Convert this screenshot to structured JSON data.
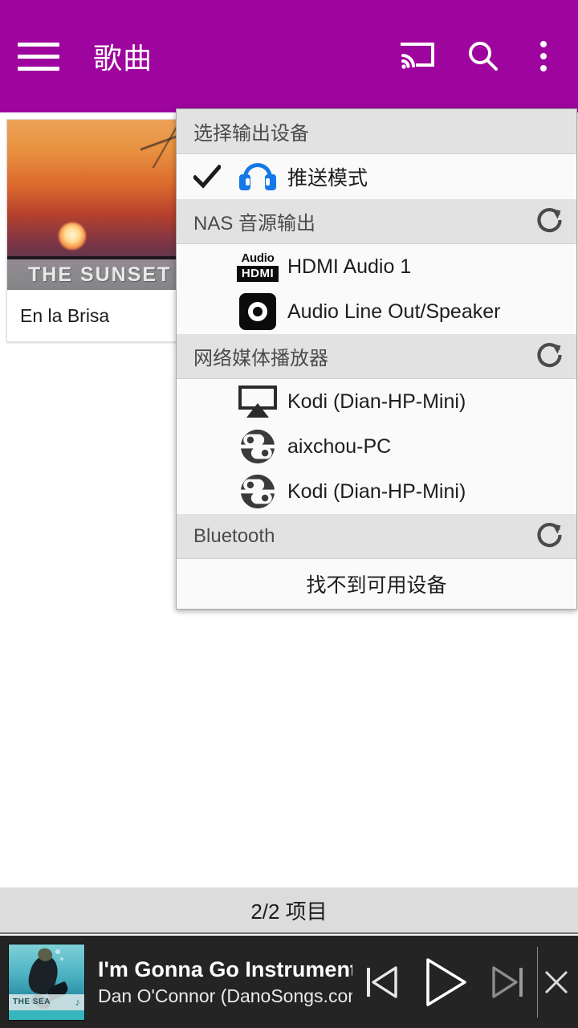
{
  "appbar": {
    "title": "歌曲",
    "menu_icon": "hamburger-menu-icon",
    "cast_icon": "cast-icon",
    "search_icon": "search-icon",
    "overflow_icon": "more-vertical-icon",
    "background_color": "#9E059E"
  },
  "content": {
    "cards": [
      {
        "title": "En la Brisa",
        "art_banner_text": "THE SUNSET"
      }
    ]
  },
  "output_menu": {
    "header": "选择输出设备",
    "push_mode": {
      "label": "推送模式",
      "checked": true,
      "icon": "headphones-icon",
      "icon_color": "#1478E8"
    },
    "sections": [
      {
        "title": "NAS 音源输出",
        "refresh_icon": "refresh-icon",
        "items": [
          {
            "label": "HDMI Audio 1",
            "icon": "hdmi-audio-icon",
            "icon_top_text": "Audio",
            "icon_box_text": "HDMI"
          },
          {
            "label": "Audio Line Out/Speaker",
            "icon": "speaker-ring-icon"
          }
        ]
      },
      {
        "title": "网络媒体播放器",
        "refresh_icon": "refresh-icon",
        "items": [
          {
            "label": "Kodi (Dian-HP-Mini)",
            "icon": "airplay-icon"
          },
          {
            "label": "aixchou-PC",
            "icon": "dlna-icon"
          },
          {
            "label": "Kodi (Dian-HP-Mini)",
            "icon": "dlna-icon"
          }
        ]
      },
      {
        "title": "Bluetooth",
        "refresh_icon": "refresh-icon",
        "empty_text": "找不到可用设备",
        "items": []
      }
    ]
  },
  "count_bar": {
    "text": "2/2 项目"
  },
  "player": {
    "title": "I'm Gonna Go Instrumental",
    "artist": "Dan O'Connor (DanoSongs.com)",
    "art_caption": "THE SEA",
    "art_note_icon": "music-note-icon",
    "prev_icon": "skip-previous-icon",
    "play_icon": "play-icon",
    "next_icon": "skip-next-icon",
    "close_icon": "close-icon"
  }
}
